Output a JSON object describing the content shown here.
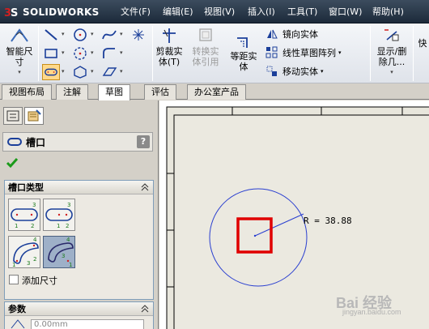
{
  "app": {
    "logo_text": "SOLIDWORKS",
    "menus": [
      "文件(F)",
      "编辑(E)",
      "视图(V)",
      "插入(I)",
      "工具(T)",
      "窗口(W)",
      "帮助(H)"
    ]
  },
  "toolbar": {
    "smart_dimension": "智能尺寸",
    "trim": "剪裁实体(T)",
    "convert": "转换实体引用",
    "offset": "等距实体",
    "mirror": "镜向实体",
    "linear_pattern": "线性草图阵列",
    "move": "移动实体",
    "show_delete": "显示/删除几...",
    "quick": "快"
  },
  "tabs": [
    "视图布局",
    "注解",
    "草图",
    "评估",
    "办公室产品"
  ],
  "active_tab": "草图",
  "property_manager": {
    "title": "槽口",
    "help": "?",
    "slot_type_group": "槽口类型",
    "add_dimensions": "添加尺寸",
    "params_group": "参数",
    "param_value": "0.00mm"
  },
  "graphics": {
    "radius_label": "R = 38.88",
    "circle_color": "#2a3fd0",
    "highlight_color": "#e00000"
  },
  "watermark": {
    "text": "Bai 经验",
    "url": "jingyan.baidu.com"
  },
  "colors": {
    "titlebar": "#1c2a3a",
    "active_tool": "#ffd98a"
  }
}
